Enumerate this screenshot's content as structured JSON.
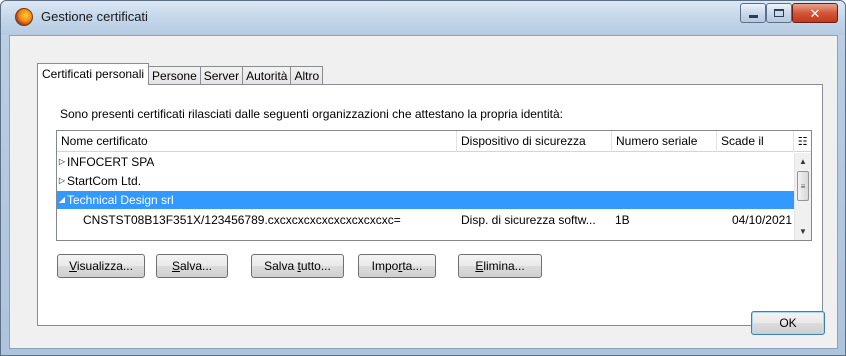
{
  "window": {
    "title": "Gestione certificati"
  },
  "tabs": [
    {
      "label": "Certificati personali",
      "active": true
    },
    {
      "label": "Persone",
      "active": false
    },
    {
      "label": "Server",
      "active": false
    },
    {
      "label": "Autorità",
      "active": false
    },
    {
      "label": "Altro",
      "active": false
    }
  ],
  "panel": {
    "intro": "Sono presenti certificati rilasciati dalle seguenti organizzazioni che attestano la propria identità:"
  },
  "tree": {
    "columns": {
      "name": "Nome certificato",
      "device": "Dispositivo di sicurezza",
      "serial": "Numero seriale",
      "expires": "Scade il"
    },
    "rows": [
      {
        "kind": "group",
        "expanded": false,
        "name": "INFOCERT SPA"
      },
      {
        "kind": "group",
        "expanded": false,
        "name": "StartCom Ltd."
      },
      {
        "kind": "group",
        "expanded": true,
        "selected": true,
        "name": "Technical Design srl"
      },
      {
        "kind": "cert",
        "name": "CNSTST08B13F351X/123456789.cxcxcxcxcxcxcxcxcxcxc=",
        "device": "Disp. di sicurezza softw...",
        "serial": "1B",
        "expires": "04/10/2021"
      }
    ]
  },
  "buttons": {
    "view_pre": "",
    "view_key": "V",
    "view_post": "isualizza...",
    "save_pre": "",
    "save_key": "S",
    "save_post": "alva...",
    "saveall_pre": "Salva ",
    "saveall_key": "t",
    "saveall_post": "utto...",
    "import_pre": "Impo",
    "import_key": "r",
    "import_post": "ta...",
    "delete_pre": "",
    "delete_key": "E",
    "delete_post": "limina...",
    "ok": "OK"
  },
  "colors": {
    "selection": "#3399ff",
    "close_button": "#c2391a"
  }
}
